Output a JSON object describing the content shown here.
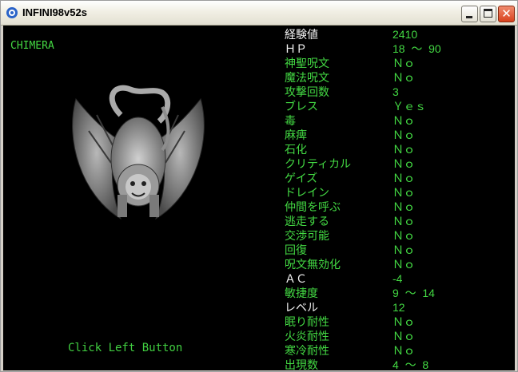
{
  "window": {
    "title": "INFINI98v52s",
    "minimize_icon": "minimize-icon",
    "maximize_icon": "maximize-icon",
    "close_icon": "close-icon"
  },
  "monster": {
    "name": "CHIMERA",
    "image": "chimera-icon"
  },
  "hint": "Click Left Button",
  "colors": {
    "text_green": "#43d943",
    "text_white": "#f2f2f2",
    "background": "#000000"
  },
  "stats": [
    {
      "label": "経験値",
      "value": "2410",
      "white": true
    },
    {
      "label": "ＨＰ",
      "value": "18  ～  90",
      "white": true
    },
    {
      "label": "神聖呪文",
      "value": "Ｎｏ",
      "white": false
    },
    {
      "label": "魔法呪文",
      "value": "Ｎｏ",
      "white": false
    },
    {
      "label": "攻撃回数",
      "value": "3",
      "white": false
    },
    {
      "label": "ブレス",
      "value": "Ｙｅｓ",
      "white": false
    },
    {
      "label": "毒",
      "value": "Ｎｏ",
      "white": false
    },
    {
      "label": "麻痺",
      "value": "Ｎｏ",
      "white": false
    },
    {
      "label": "石化",
      "value": "Ｎｏ",
      "white": false
    },
    {
      "label": "クリティカル",
      "value": "Ｎｏ",
      "white": false
    },
    {
      "label": "ゲイズ",
      "value": "Ｎｏ",
      "white": false
    },
    {
      "label": "ドレイン",
      "value": "Ｎｏ",
      "white": false
    },
    {
      "label": "仲間を呼ぶ",
      "value": "Ｎｏ",
      "white": false
    },
    {
      "label": "逃走する",
      "value": "Ｎｏ",
      "white": false
    },
    {
      "label": "交渉可能",
      "value": "Ｎｏ",
      "white": false
    },
    {
      "label": "回復",
      "value": "Ｎｏ",
      "white": false
    },
    {
      "label": "呪文無効化",
      "value": "Ｎｏ",
      "white": false
    },
    {
      "label": "ＡＣ",
      "value": "-4",
      "white": true
    },
    {
      "label": "敏捷度",
      "value": "9  ～  14",
      "white": false
    },
    {
      "label": "レベル",
      "value": "12",
      "white": true
    },
    {
      "label": "眠り耐性",
      "value": "Ｎｏ",
      "white": false
    },
    {
      "label": "火炎耐性",
      "value": "Ｎｏ",
      "white": false
    },
    {
      "label": "寒冷耐性",
      "value": "Ｎｏ",
      "white": false
    },
    {
      "label": "出現数",
      "value": "4  ～  8",
      "white": false
    }
  ]
}
